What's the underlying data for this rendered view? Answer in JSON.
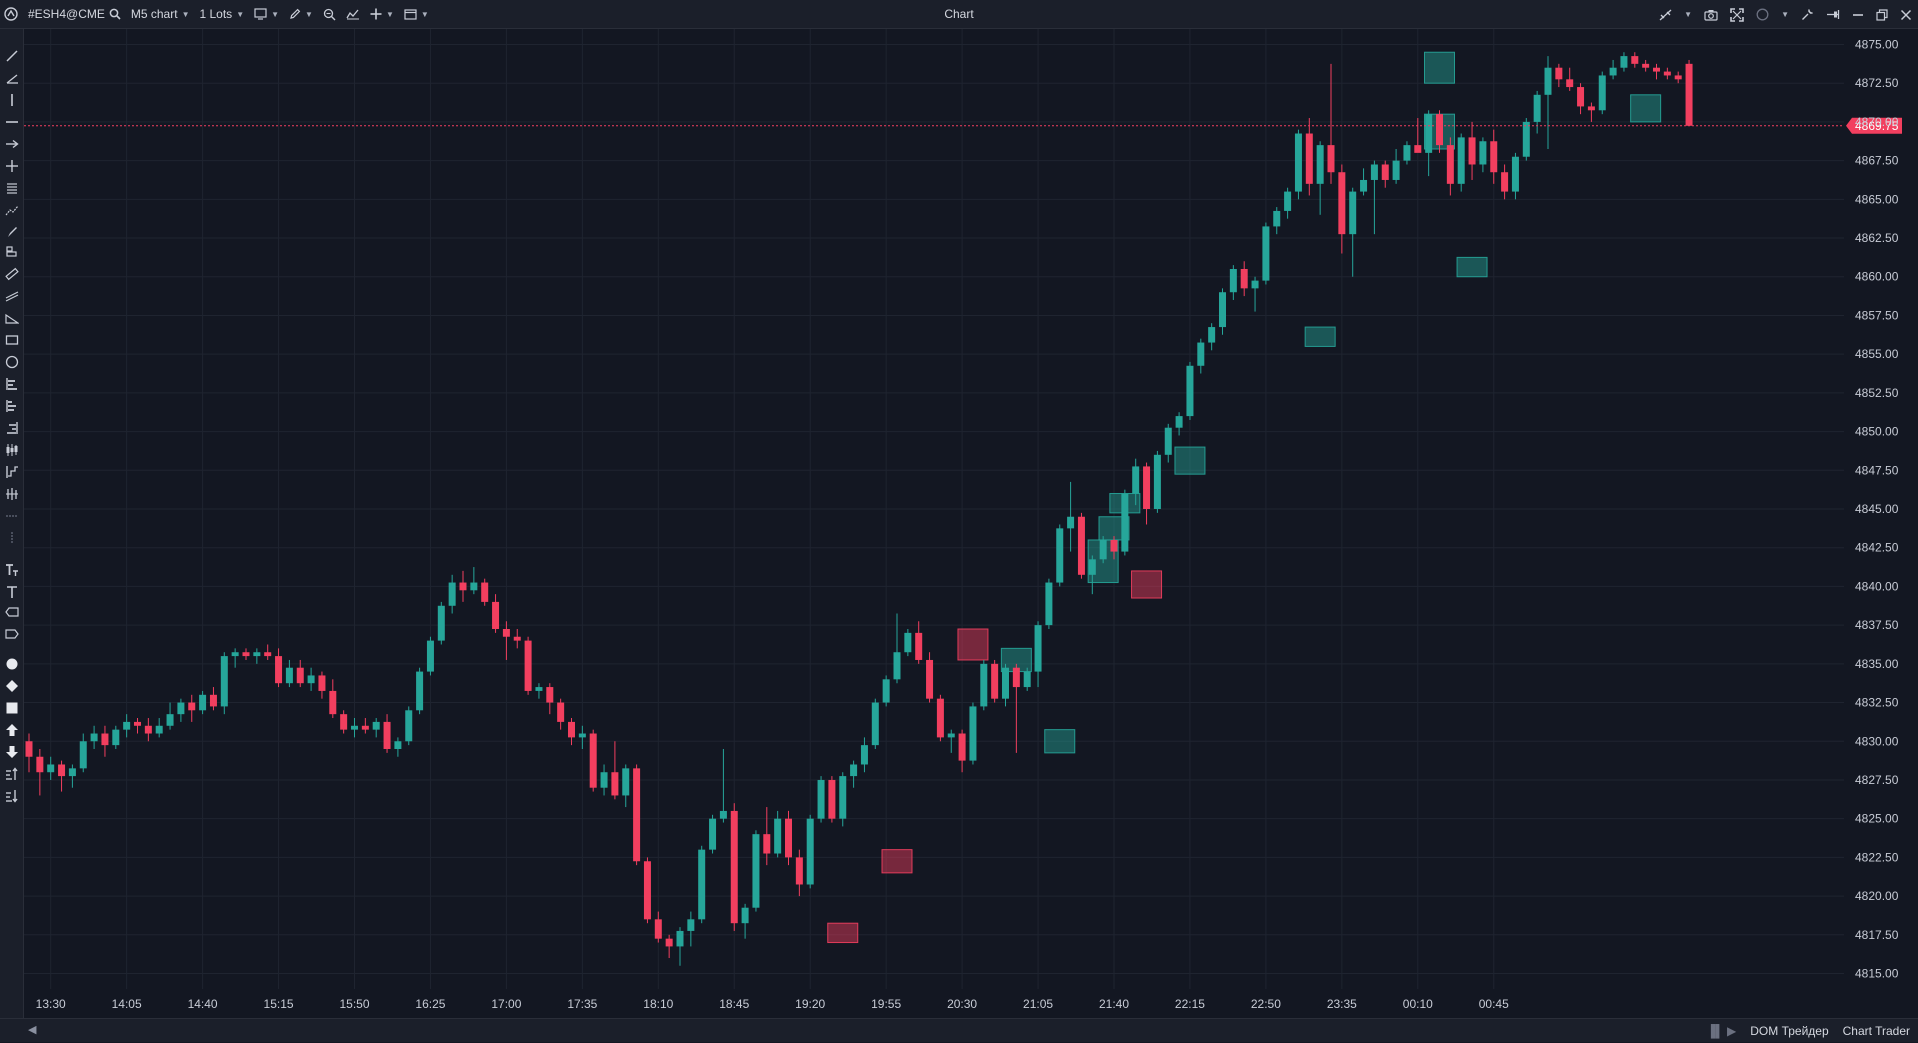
{
  "toolbar": {
    "symbol": "#ESH4@CME",
    "timeframe": "M5 chart",
    "lots": "1 Lots",
    "title": "Chart"
  },
  "bottom": {
    "dom_label": "DOM Трейдер",
    "chart_trader_label": "Chart Trader"
  },
  "icons": {
    "top_left": [
      "app-logo-icon",
      "search-icon",
      "chart-type-icon",
      "pencil-icon",
      "zoom-icon",
      "indicators-icon",
      "crosshair-plus-icon",
      "window-icon"
    ],
    "top_right": [
      "link-off-icon",
      "camera-icon",
      "fullscreen-icon",
      "circle-icon",
      "wrench-icon",
      "pin-icon",
      "minimize-icon",
      "restore-icon",
      "close-icon"
    ]
  },
  "colors": {
    "bull": "#26a69a",
    "bear": "#f23f5f",
    "background": "#131722",
    "grid": "#1f2430",
    "price_line": "#f23f5f"
  },
  "chart_data": {
    "type": "candlestick",
    "title": "",
    "xlabel": "",
    "ylabel": "",
    "symbol": "#ESH4@CME",
    "timeframe": "M5",
    "current_price": "4869.75",
    "ylim": [
      4814.0,
      4876.0
    ],
    "y_ticks": [
      "4815.00",
      "4817.50",
      "4820.00",
      "4822.50",
      "4825.00",
      "4827.50",
      "4830.00",
      "4832.50",
      "4835.00",
      "4837.50",
      "4840.00",
      "4842.50",
      "4845.00",
      "4847.50",
      "4850.00",
      "4852.50",
      "4855.00",
      "4857.50",
      "4860.00",
      "4862.50",
      "4865.00",
      "4867.50",
      "4870.00",
      "4872.50",
      "4875.00"
    ],
    "x_ticks": [
      "13:30",
      "14:05",
      "14:40",
      "15:15",
      "15:50",
      "16:25",
      "17:00",
      "17:35",
      "18:10",
      "18:45",
      "19:20",
      "19:55",
      "20:30",
      "21:05",
      "21:40",
      "22:15",
      "22:50",
      "23:35",
      "00:10",
      "00:45"
    ],
    "candles": [
      {
        "o": 4830.0,
        "h": 4830.5,
        "l": 4828.0,
        "c": 4829.0
      },
      {
        "o": 4829.0,
        "h": 4829.5,
        "l": 4826.5,
        "c": 4828.0
      },
      {
        "o": 4828.0,
        "h": 4829.0,
        "l": 4827.5,
        "c": 4828.5
      },
      {
        "o": 4828.5,
        "h": 4828.75,
        "l": 4826.75,
        "c": 4827.75
      },
      {
        "o": 4827.75,
        "h": 4828.5,
        "l": 4827.0,
        "c": 4828.25
      },
      {
        "o": 4828.25,
        "h": 4830.5,
        "l": 4828.0,
        "c": 4830.0
      },
      {
        "o": 4830.0,
        "h": 4831.0,
        "l": 4829.5,
        "c": 4830.5
      },
      {
        "o": 4830.5,
        "h": 4831.0,
        "l": 4829.0,
        "c": 4829.75
      },
      {
        "o": 4829.75,
        "h": 4831.0,
        "l": 4829.5,
        "c": 4830.75
      },
      {
        "o": 4830.75,
        "h": 4831.75,
        "l": 4830.25,
        "c": 4831.25
      },
      {
        "o": 4831.25,
        "h": 4831.5,
        "l": 4830.5,
        "c": 4831.0
      },
      {
        "o": 4831.0,
        "h": 4831.5,
        "l": 4830.0,
        "c": 4830.5
      },
      {
        "o": 4830.5,
        "h": 4831.5,
        "l": 4830.25,
        "c": 4831.0
      },
      {
        "o": 4831.0,
        "h": 4832.5,
        "l": 4830.75,
        "c": 4831.75
      },
      {
        "o": 4831.75,
        "h": 4832.75,
        "l": 4831.25,
        "c": 4832.5
      },
      {
        "o": 4832.5,
        "h": 4833.0,
        "l": 4831.25,
        "c": 4832.0
      },
      {
        "o": 4832.0,
        "h": 4833.25,
        "l": 4831.75,
        "c": 4833.0
      },
      {
        "o": 4833.0,
        "h": 4833.5,
        "l": 4832.0,
        "c": 4832.25
      },
      {
        "o": 4832.25,
        "h": 4835.75,
        "l": 4831.75,
        "c": 4835.5
      },
      {
        "o": 4835.5,
        "h": 4836.0,
        "l": 4834.75,
        "c": 4835.75
      },
      {
        "o": 4835.75,
        "h": 4836.0,
        "l": 4835.25,
        "c": 4835.5
      },
      {
        "o": 4835.5,
        "h": 4836.0,
        "l": 4835.0,
        "c": 4835.75
      },
      {
        "o": 4835.75,
        "h": 4836.25,
        "l": 4835.25,
        "c": 4835.5
      },
      {
        "o": 4835.5,
        "h": 4836.0,
        "l": 4833.5,
        "c": 4833.75
      },
      {
        "o": 4833.75,
        "h": 4835.25,
        "l": 4833.5,
        "c": 4834.75
      },
      {
        "o": 4834.75,
        "h": 4835.25,
        "l": 4833.5,
        "c": 4833.75
      },
      {
        "o": 4833.75,
        "h": 4834.75,
        "l": 4833.25,
        "c": 4834.25
      },
      {
        "o": 4834.25,
        "h": 4834.5,
        "l": 4832.75,
        "c": 4833.25
      },
      {
        "o": 4833.25,
        "h": 4834.0,
        "l": 4831.5,
        "c": 4831.75
      },
      {
        "o": 4831.75,
        "h": 4832.0,
        "l": 4830.5,
        "c": 4830.75
      },
      {
        "o": 4830.75,
        "h": 4831.5,
        "l": 4830.25,
        "c": 4831.0
      },
      {
        "o": 4831.0,
        "h": 4831.5,
        "l": 4830.5,
        "c": 4830.75
      },
      {
        "o": 4830.75,
        "h": 4831.5,
        "l": 4830.25,
        "c": 4831.25
      },
      {
        "o": 4831.25,
        "h": 4831.75,
        "l": 4829.25,
        "c": 4829.5
      },
      {
        "o": 4829.5,
        "h": 4830.25,
        "l": 4829.0,
        "c": 4830.0
      },
      {
        "o": 4830.0,
        "h": 4832.25,
        "l": 4829.75,
        "c": 4832.0
      },
      {
        "o": 4832.0,
        "h": 4834.75,
        "l": 4831.75,
        "c": 4834.5
      },
      {
        "o": 4834.5,
        "h": 4836.75,
        "l": 4834.25,
        "c": 4836.5
      },
      {
        "o": 4836.5,
        "h": 4839.0,
        "l": 4836.25,
        "c": 4838.75
      },
      {
        "o": 4838.75,
        "h": 4840.75,
        "l": 4838.25,
        "c": 4840.25
      },
      {
        "o": 4840.25,
        "h": 4841.0,
        "l": 4839.0,
        "c": 4839.75
      },
      {
        "o": 4839.75,
        "h": 4841.25,
        "l": 4839.5,
        "c": 4840.25
      },
      {
        "o": 4840.25,
        "h": 4840.5,
        "l": 4838.75,
        "c": 4839.0
      },
      {
        "o": 4839.0,
        "h": 4839.5,
        "l": 4837.0,
        "c": 4837.25
      },
      {
        "o": 4837.25,
        "h": 4837.75,
        "l": 4835.25,
        "c": 4836.75
      },
      {
        "o": 4836.75,
        "h": 4837.25,
        "l": 4836.0,
        "c": 4836.5
      },
      {
        "o": 4836.5,
        "h": 4836.75,
        "l": 4833.0,
        "c": 4833.25
      },
      {
        "o": 4833.25,
        "h": 4833.75,
        "l": 4832.75,
        "c": 4833.5
      },
      {
        "o": 4833.5,
        "h": 4833.75,
        "l": 4831.75,
        "c": 4832.5
      },
      {
        "o": 4832.5,
        "h": 4832.75,
        "l": 4830.75,
        "c": 4831.25
      },
      {
        "o": 4831.25,
        "h": 4831.5,
        "l": 4829.75,
        "c": 4830.25
      },
      {
        "o": 4830.25,
        "h": 4831.0,
        "l": 4829.5,
        "c": 4830.5
      },
      {
        "o": 4830.5,
        "h": 4830.75,
        "l": 4826.75,
        "c": 4827.0
      },
      {
        "o": 4827.0,
        "h": 4828.5,
        "l": 4826.5,
        "c": 4828.0
      },
      {
        "o": 4828.0,
        "h": 4830.0,
        "l": 4826.25,
        "c": 4826.5
      },
      {
        "o": 4826.5,
        "h": 4828.5,
        "l": 4825.75,
        "c": 4828.25
      },
      {
        "o": 4828.25,
        "h": 4828.5,
        "l": 4822.0,
        "c": 4822.25
      },
      {
        "o": 4822.25,
        "h": 4822.5,
        "l": 4818.25,
        "c": 4818.5
      },
      {
        "o": 4818.5,
        "h": 4819.0,
        "l": 4817.0,
        "c": 4817.25
      },
      {
        "o": 4817.25,
        "h": 4817.5,
        "l": 4816.0,
        "c": 4816.75
      },
      {
        "o": 4816.75,
        "h": 4818.0,
        "l": 4815.5,
        "c": 4817.75
      },
      {
        "o": 4817.75,
        "h": 4819.0,
        "l": 4816.75,
        "c": 4818.5
      },
      {
        "o": 4818.5,
        "h": 4823.25,
        "l": 4818.25,
        "c": 4823.0
      },
      {
        "o": 4823.0,
        "h": 4825.25,
        "l": 4822.75,
        "c": 4825.0
      },
      {
        "o": 4825.0,
        "h": 4829.5,
        "l": 4824.75,
        "c": 4825.5
      },
      {
        "o": 4825.5,
        "h": 4826.0,
        "l": 4817.75,
        "c": 4818.25
      },
      {
        "o": 4818.25,
        "h": 4819.5,
        "l": 4817.25,
        "c": 4819.25
      },
      {
        "o": 4819.25,
        "h": 4824.25,
        "l": 4819.0,
        "c": 4824.0
      },
      {
        "o": 4824.0,
        "h": 4825.75,
        "l": 4822.0,
        "c": 4822.75
      },
      {
        "o": 4822.75,
        "h": 4825.5,
        "l": 4822.5,
        "c": 4825.0
      },
      {
        "o": 4825.0,
        "h": 4825.5,
        "l": 4822.0,
        "c": 4822.5
      },
      {
        "o": 4822.5,
        "h": 4823.0,
        "l": 4820.0,
        "c": 4820.75
      },
      {
        "o": 4820.75,
        "h": 4825.25,
        "l": 4820.5,
        "c": 4825.0
      },
      {
        "o": 4825.0,
        "h": 4827.75,
        "l": 4824.75,
        "c": 4827.5
      },
      {
        "o": 4827.5,
        "h": 4827.75,
        "l": 4824.75,
        "c": 4825.0
      },
      {
        "o": 4825.0,
        "h": 4828.0,
        "l": 4824.5,
        "c": 4827.75
      },
      {
        "o": 4827.75,
        "h": 4828.75,
        "l": 4827.0,
        "c": 4828.5
      },
      {
        "o": 4828.5,
        "h": 4830.25,
        "l": 4828.0,
        "c": 4829.75
      },
      {
        "o": 4829.75,
        "h": 4832.75,
        "l": 4829.5,
        "c": 4832.5
      },
      {
        "o": 4832.5,
        "h": 4834.25,
        "l": 4832.25,
        "c": 4834.0
      },
      {
        "o": 4834.0,
        "h": 4838.25,
        "l": 4833.75,
        "c": 4835.75
      },
      {
        "o": 4835.75,
        "h": 4837.25,
        "l": 4835.5,
        "c": 4837.0
      },
      {
        "o": 4837.0,
        "h": 4837.75,
        "l": 4835.0,
        "c": 4835.25
      },
      {
        "o": 4835.25,
        "h": 4835.75,
        "l": 4832.5,
        "c": 4832.75
      },
      {
        "o": 4832.75,
        "h": 4833.0,
        "l": 4830.0,
        "c": 4830.25
      },
      {
        "o": 4830.25,
        "h": 4830.75,
        "l": 4829.25,
        "c": 4830.5
      },
      {
        "o": 4830.5,
        "h": 4830.75,
        "l": 4828.0,
        "c": 4828.75
      },
      {
        "o": 4828.75,
        "h": 4832.5,
        "l": 4828.5,
        "c": 4832.25
      },
      {
        "o": 4832.25,
        "h": 4835.25,
        "l": 4832.0,
        "c": 4835.0
      },
      {
        "o": 4835.0,
        "h": 4835.25,
        "l": 4832.5,
        "c": 4832.75
      },
      {
        "o": 4832.75,
        "h": 4835.0,
        "l": 4832.25,
        "c": 4834.75
      },
      {
        "o": 4834.75,
        "h": 4835.0,
        "l": 4829.25,
        "c": 4833.5
      },
      {
        "o": 4833.5,
        "h": 4834.75,
        "l": 4833.25,
        "c": 4834.5
      },
      {
        "o": 4834.5,
        "h": 4837.75,
        "l": 4833.5,
        "c": 4837.5
      },
      {
        "o": 4837.5,
        "h": 4840.5,
        "l": 4837.25,
        "c": 4840.25
      },
      {
        "o": 4840.25,
        "h": 4844.0,
        "l": 4840.0,
        "c": 4843.75
      },
      {
        "o": 4843.75,
        "h": 4846.75,
        "l": 4842.25,
        "c": 4844.5
      },
      {
        "o": 4844.5,
        "h": 4844.75,
        "l": 4840.5,
        "c": 4840.75
      },
      {
        "o": 4840.75,
        "h": 4842.0,
        "l": 4839.5,
        "c": 4841.75
      },
      {
        "o": 4841.75,
        "h": 4843.25,
        "l": 4841.5,
        "c": 4843.0
      },
      {
        "o": 4843.0,
        "h": 4843.25,
        "l": 4841.75,
        "c": 4842.25
      },
      {
        "o": 4842.25,
        "h": 4846.25,
        "l": 4842.0,
        "c": 4846.0
      },
      {
        "o": 4846.0,
        "h": 4848.25,
        "l": 4845.25,
        "c": 4847.75
      },
      {
        "o": 4847.75,
        "h": 4848.0,
        "l": 4844.0,
        "c": 4845.0
      },
      {
        "o": 4845.0,
        "h": 4848.75,
        "l": 4844.75,
        "c": 4848.5
      },
      {
        "o": 4848.5,
        "h": 4850.5,
        "l": 4848.0,
        "c": 4850.25
      },
      {
        "o": 4850.25,
        "h": 4851.25,
        "l": 4849.75,
        "c": 4851.0
      },
      {
        "o": 4851.0,
        "h": 4854.5,
        "l": 4850.75,
        "c": 4854.25
      },
      {
        "o": 4854.25,
        "h": 4856.0,
        "l": 4853.75,
        "c": 4855.75
      },
      {
        "o": 4855.75,
        "h": 4857.0,
        "l": 4855.25,
        "c": 4856.75
      },
      {
        "o": 4856.75,
        "h": 4859.25,
        "l": 4856.25,
        "c": 4859.0
      },
      {
        "o": 4859.0,
        "h": 4860.75,
        "l": 4858.5,
        "c": 4860.5
      },
      {
        "o": 4860.5,
        "h": 4861.0,
        "l": 4858.75,
        "c": 4859.25
      },
      {
        "o": 4859.25,
        "h": 4860.0,
        "l": 4857.75,
        "c": 4859.75
      },
      {
        "o": 4859.75,
        "h": 4863.5,
        "l": 4859.5,
        "c": 4863.25
      },
      {
        "o": 4863.25,
        "h": 4864.5,
        "l": 4862.75,
        "c": 4864.25
      },
      {
        "o": 4864.25,
        "h": 4865.75,
        "l": 4863.75,
        "c": 4865.5
      },
      {
        "o": 4865.5,
        "h": 4869.5,
        "l": 4865.0,
        "c": 4869.25
      },
      {
        "o": 4869.25,
        "h": 4870.25,
        "l": 4865.25,
        "c": 4866.0
      },
      {
        "o": 4866.0,
        "h": 4868.75,
        "l": 4864.0,
        "c": 4868.5
      },
      {
        "o": 4868.5,
        "h": 4873.75,
        "l": 4866.0,
        "c": 4866.75
      },
      {
        "o": 4866.75,
        "h": 4867.25,
        "l": 4861.5,
        "c": 4862.75
      },
      {
        "o": 4862.75,
        "h": 4865.75,
        "l": 4860.0,
        "c": 4865.5
      },
      {
        "o": 4865.5,
        "h": 4867.0,
        "l": 4865.25,
        "c": 4866.25
      },
      {
        "o": 4866.25,
        "h": 4867.5,
        "l": 4862.75,
        "c": 4867.25
      },
      {
        "o": 4867.25,
        "h": 4867.5,
        "l": 4865.75,
        "c": 4866.25
      },
      {
        "o": 4866.25,
        "h": 4868.25,
        "l": 4866.0,
        "c": 4867.5
      },
      {
        "o": 4867.5,
        "h": 4868.75,
        "l": 4867.25,
        "c": 4868.5
      },
      {
        "o": 4868.5,
        "h": 4870.25,
        "l": 4868.25,
        "c": 4868.0
      },
      {
        "o": 4868.0,
        "h": 4870.75,
        "l": 4866.5,
        "c": 4870.5
      },
      {
        "o": 4870.5,
        "h": 4870.75,
        "l": 4868.0,
        "c": 4868.5
      },
      {
        "o": 4868.5,
        "h": 4869.0,
        "l": 4865.25,
        "c": 4866.0
      },
      {
        "o": 4866.0,
        "h": 4869.25,
        "l": 4865.5,
        "c": 4869.0
      },
      {
        "o": 4869.0,
        "h": 4870.0,
        "l": 4866.25,
        "c": 4867.25
      },
      {
        "o": 4867.25,
        "h": 4869.0,
        "l": 4866.75,
        "c": 4868.75
      },
      {
        "o": 4868.75,
        "h": 4869.5,
        "l": 4866.0,
        "c": 4866.75
      },
      {
        "o": 4866.75,
        "h": 4867.25,
        "l": 4865.0,
        "c": 4865.5
      },
      {
        "o": 4865.5,
        "h": 4868.0,
        "l": 4865.0,
        "c": 4867.75
      },
      {
        "o": 4867.75,
        "h": 4870.25,
        "l": 4867.5,
        "c": 4870.0
      },
      {
        "o": 4870.0,
        "h": 4872.0,
        "l": 4869.25,
        "c": 4871.75
      },
      {
        "o": 4871.75,
        "h": 4874.25,
        "l": 4868.25,
        "c": 4873.5
      },
      {
        "o": 4873.5,
        "h": 4873.75,
        "l": 4872.25,
        "c": 4872.75
      },
      {
        "o": 4872.75,
        "h": 4873.5,
        "l": 4872.0,
        "c": 4872.25
      },
      {
        "o": 4872.25,
        "h": 4872.5,
        "l": 4870.5,
        "c": 4871.0
      },
      {
        "o": 4871.0,
        "h": 4871.25,
        "l": 4870.0,
        "c": 4870.75
      },
      {
        "o": 4870.75,
        "h": 4873.25,
        "l": 4870.5,
        "c": 4873.0
      },
      {
        "o": 4873.0,
        "h": 4874.0,
        "l": 4872.75,
        "c": 4873.5
      },
      {
        "o": 4873.5,
        "h": 4874.5,
        "l": 4873.25,
        "c": 4874.25
      },
      {
        "o": 4874.25,
        "h": 4874.5,
        "l": 4873.5,
        "c": 4873.75
      },
      {
        "o": 4873.75,
        "h": 4874.0,
        "l": 4873.25,
        "c": 4873.5
      },
      {
        "o": 4873.5,
        "h": 4873.75,
        "l": 4872.75,
        "c": 4873.25
      },
      {
        "o": 4873.25,
        "h": 4873.5,
        "l": 4872.75,
        "c": 4873.0
      },
      {
        "o": 4873.0,
        "h": 4873.25,
        "l": 4872.5,
        "c": 4872.75
      },
      {
        "o": 4873.75,
        "h": 4874.0,
        "l": 4869.75,
        "c": 4869.75
      }
    ],
    "boxes": [
      {
        "i": 75,
        "lo": 4817.0,
        "hi": 4818.25,
        "kind": "bear"
      },
      {
        "i": 80,
        "lo": 4821.5,
        "hi": 4823.0,
        "kind": "bear"
      },
      {
        "i": 87,
        "lo": 4835.25,
        "hi": 4837.25,
        "kind": "bear"
      },
      {
        "i": 91,
        "lo": 4834.5,
        "hi": 4836.0,
        "kind": "bull"
      },
      {
        "i": 95,
        "lo": 4829.25,
        "hi": 4830.75,
        "kind": "bull"
      },
      {
        "i": 99,
        "lo": 4840.25,
        "hi": 4843.0,
        "kind": "bull"
      },
      {
        "i": 100,
        "lo": 4843.0,
        "hi": 4844.5,
        "kind": "bull"
      },
      {
        "i": 101,
        "lo": 4844.75,
        "hi": 4846.0,
        "kind": "bull"
      },
      {
        "i": 103,
        "lo": 4839.25,
        "hi": 4841.0,
        "kind": "bear"
      },
      {
        "i": 107,
        "lo": 4847.25,
        "hi": 4849.0,
        "kind": "bull"
      },
      {
        "i": 119,
        "lo": 4855.5,
        "hi": 4856.75,
        "kind": "bull"
      },
      {
        "i": 130,
        "lo": 4868.25,
        "hi": 4870.5,
        "kind": "bull"
      },
      {
        "i": 130,
        "lo": 4872.5,
        "hi": 4874.5,
        "kind": "bull"
      },
      {
        "i": 133,
        "lo": 4860.0,
        "hi": 4861.25,
        "kind": "bull"
      },
      {
        "i": 149,
        "lo": 4870.0,
        "hi": 4871.75,
        "kind": "bull"
      }
    ]
  }
}
